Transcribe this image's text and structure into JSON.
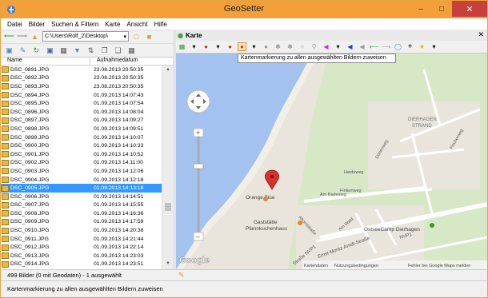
{
  "window": {
    "title": "GeoSetter"
  },
  "menu": [
    "Datei",
    "Bilder",
    "Suchen & Filtern",
    "Karte",
    "Ansicht",
    "Hilfe"
  ],
  "left_toolbar": {
    "path": "C:\\Users\\Rolf_2\\Desktop\\"
  },
  "file_list": {
    "col_name": "Name",
    "col_date": "Aufnahmedatum",
    "rows": [
      {
        "name": "DSC_0891.JPG",
        "date": "23.08.2013 20:50:35"
      },
      {
        "name": "DSC_0892.JPG",
        "date": "23.08.2013 20:50:35"
      },
      {
        "name": "DSC_0893.JPG",
        "date": "23.08.2013 20:50:35"
      },
      {
        "name": "DSC_0894.JPG",
        "date": "01.09.2013 14:07:43"
      },
      {
        "name": "DSC_0895.JPG",
        "date": "01.09.2013 14:07:54"
      },
      {
        "name": "DSC_0896.JPG",
        "date": "01.09.2013 14:08:04"
      },
      {
        "name": "DSC_0897.JPG",
        "date": "01.09.2013 14:09:27"
      },
      {
        "name": "DSC_0898.JPG",
        "date": "01.09.2013 14:09:51"
      },
      {
        "name": "DSC_0899.JPG",
        "date": "01.09.2013 14:10:07"
      },
      {
        "name": "DSC_0900.JPG",
        "date": "01.09.2013 14:10:33"
      },
      {
        "name": "DSC_0901.JPG",
        "date": "01.09.2013 14:10:52"
      },
      {
        "name": "DSC_0902.JPG",
        "date": "01.09.2013 14:11:00"
      },
      {
        "name": "DSC_0903.JPG",
        "date": "01.09.2013 14:12:06"
      },
      {
        "name": "DSC_0904.JPG",
        "date": "01.09.2013 14:12:18"
      },
      {
        "name": "DSC_0905.JPG",
        "date": "01.09.2013 14:13:18"
      },
      {
        "name": "DSC_0906.JPG",
        "date": "01.09.2013 14:14:51"
      },
      {
        "name": "DSC_0907.JPG",
        "date": "01.09.2013 14:15:55"
      },
      {
        "name": "DSC_0908.JPG",
        "date": "01.09.2013 14:16:36"
      },
      {
        "name": "DSC_0909.JPG",
        "date": "01.09.2013 14:17:59"
      },
      {
        "name": "DSC_0910.JPG",
        "date": "01.09.2013 14:20:38"
      },
      {
        "name": "DSC_0911.JPG",
        "date": "01.09.2013 14:21:44"
      },
      {
        "name": "DSC_0912.JPG",
        "date": "01.09.2013 14:22:14"
      },
      {
        "name": "DSC_0913.JPG",
        "date": "01.09.2013 14:23:03"
      },
      {
        "name": "DSC_0914.JPG",
        "date": "01.09.2013 14:23:51"
      }
    ],
    "selected_index": 14
  },
  "map_panel": {
    "title": "Karte",
    "tooltip": "Kartenmarkierung zu allen ausgewählten Bildern zuweisen",
    "labels": {
      "dierhagen_1": "DIERHAGEN",
      "dierhagen_2": "STRAND",
      "duenenweg": "Dünenweg",
      "heideweg": "Heideweg",
      "finkenweg": "Finkenweg",
      "fischerweg": "Fischerweg",
      "am_badesteg": "Am Badesteg",
      "ahornstrasse": "Ahornstraße",
      "am_wald": "Am Wald",
      "orange_blue": "Orange Blue",
      "gaststaette_1": "Gaststätte",
      "gaststaette_2": "Pfannkuchenhaus",
      "ostseecamp": "OstseeCamp Dierhagen",
      "strasse_1": "Straße NVP1",
      "strasse_2": "Ernst-Moritz-Arndt-Straße",
      "strasse_3": "NVP1",
      "google": "Google",
      "kartendaten": "Kartendaten",
      "nutzung": "Nutzungsbedingungen",
      "fehler": "Fehler bei Google Maps melden"
    }
  },
  "status": {
    "count": "499 Bilder (0 mit Geodaten) - 1 ausgewählt",
    "hint": "Kartenmarkierung zu allen ausgewählten Bildern zuweisen"
  },
  "colors": {
    "title_bar": "#f4a03a",
    "selection": "#3399ff",
    "water": "#a3c2f0",
    "land": "#e9e5dc",
    "marker": "#d9302a"
  }
}
